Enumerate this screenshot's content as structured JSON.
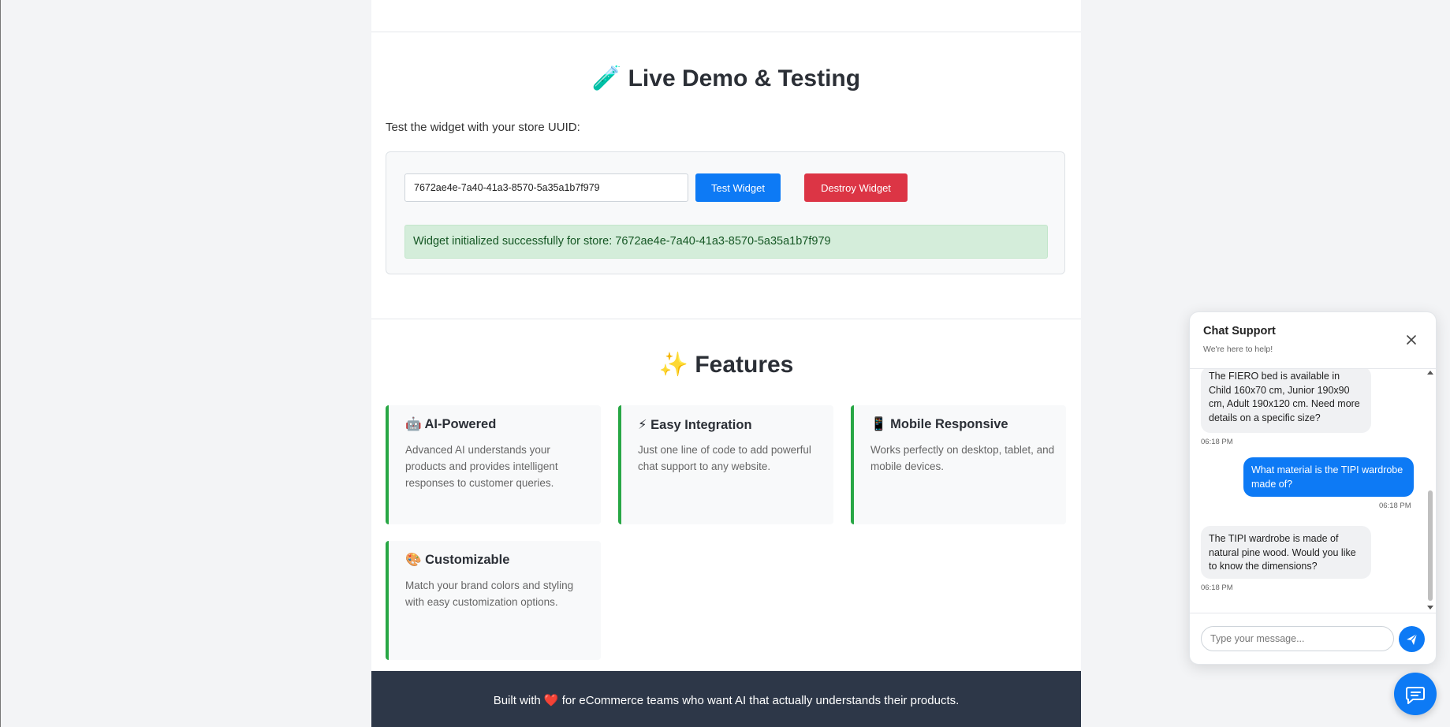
{
  "demo": {
    "title": "🧪 Live Demo & Testing",
    "intro": "Test the widget with your store UUID:",
    "uuid_value": "7672ae4e-7a40-41a3-8570-5a35a1b7f979",
    "test_button": "Test Widget",
    "destroy_button": "Destroy Widget",
    "status": "Widget initialized successfully for store: 7672ae4e-7a40-41a3-8570-5a35a1b7f979"
  },
  "features": {
    "title": "✨ Features",
    "cards": [
      {
        "title": "🤖 AI-Powered",
        "text": "Advanced AI understands your products and provides intelligent responses to customer queries."
      },
      {
        "title": "⚡ Easy Integration",
        "text": "Just one line of code to add powerful chat support to any website."
      },
      {
        "title": "📱 Mobile Responsive",
        "text": "Works perfectly on desktop, tablet, and mobile devices."
      },
      {
        "title": "🎨 Customizable",
        "text": "Match your brand colors and styling with easy customization options."
      }
    ]
  },
  "footer": {
    "text": "Built with ❤️ for eCommerce teams who want AI that actually understands their products."
  },
  "chat": {
    "title": "Chat Support",
    "subtitle": "We're here to help!",
    "messages": [
      {
        "role": "bot",
        "text": "The FIERO bed is available in Child 160x70 cm, Junior 190x90 cm, Adult 190x120 cm. Need more details on a specific size?",
        "time": "06:18 PM"
      },
      {
        "role": "user",
        "text": "What material is the TIPI wardrobe made of?",
        "time": "06:18 PM"
      },
      {
        "role": "bot",
        "text": "The TIPI wardrobe is made of natural pine wood. Would you like to know the dimensions?",
        "time": "06:18 PM"
      }
    ],
    "input_placeholder": "Type your message...",
    "icons": {
      "close": "close-icon",
      "send": "send-icon",
      "launcher": "chat-bubble-icon"
    }
  },
  "colors": {
    "primary": "#0d7af5",
    "danger": "#dc3545",
    "success_bg": "#d4edda",
    "success_text": "#155724",
    "card_accent": "#28a745",
    "footer_bg": "#2d3748"
  }
}
